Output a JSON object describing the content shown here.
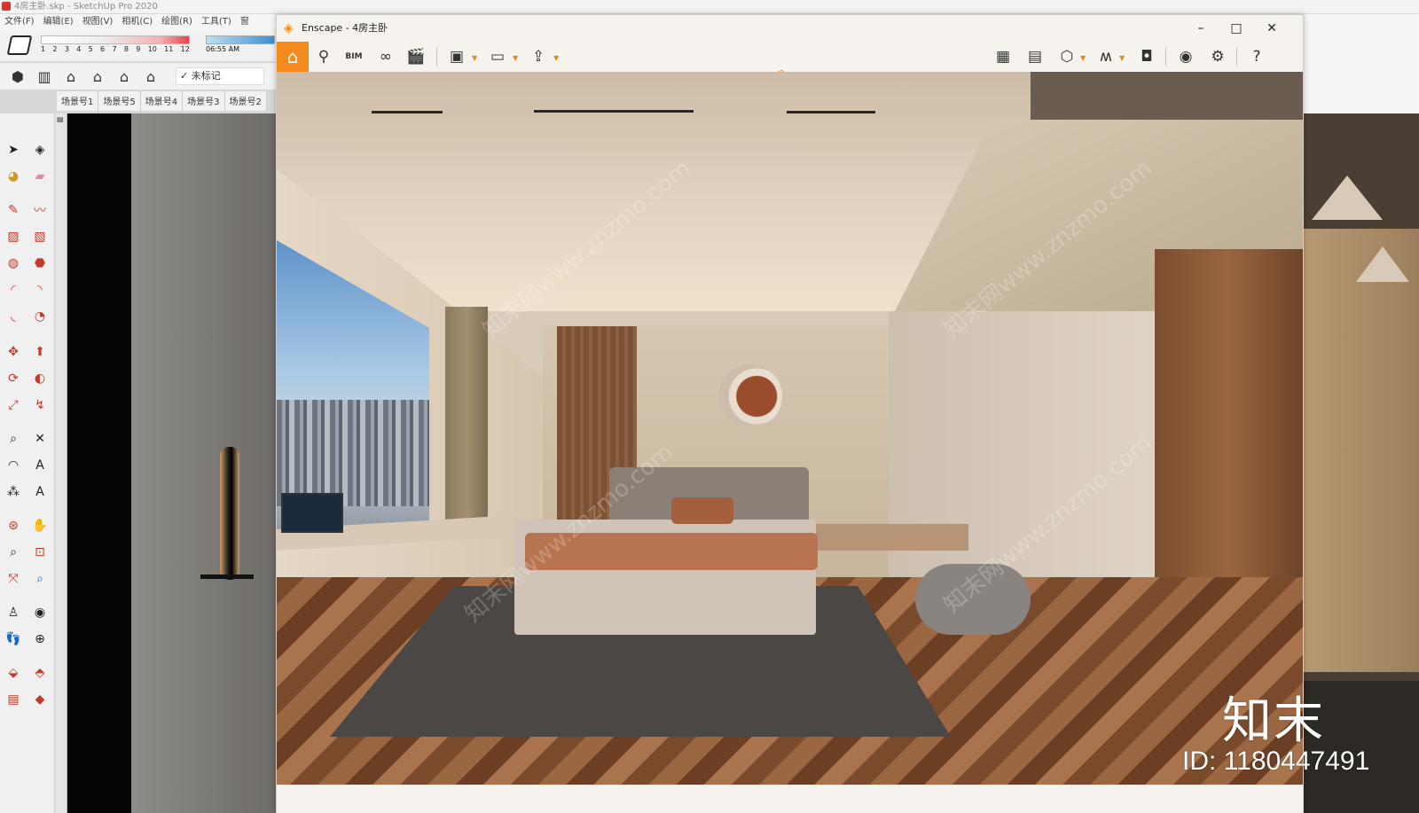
{
  "sketchup": {
    "title": "4房主卧.skp - SketchUp Pro 2020",
    "menu": [
      "文件(F)",
      "编辑(E)",
      "视图(V)",
      "相机(C)",
      "绘图(R)",
      "工具(T)",
      "窗"
    ],
    "shadow_ticks": [
      "1",
      "2",
      "3",
      "4",
      "5",
      "6",
      "7",
      "8",
      "9",
      "10",
      "11",
      "12"
    ],
    "shadow_time": "06:55 AM",
    "tag_select": "✓ 未标记",
    "scene_tabs": [
      "场景号1",
      "场景号5",
      "场景号4",
      "场景号3",
      "场景号2"
    ]
  },
  "enscape": {
    "title": "Enscape - 4房主卧",
    "bim_label": "BIM",
    "win_min": "–",
    "win_max": "□",
    "win_close": "✕"
  },
  "watermark_text": "知末网www.znzmo.com",
  "brand": {
    "logo": "知末",
    "id": "ID: 1180447491"
  },
  "colors": {
    "enscape_accent": "#f28a1e"
  }
}
